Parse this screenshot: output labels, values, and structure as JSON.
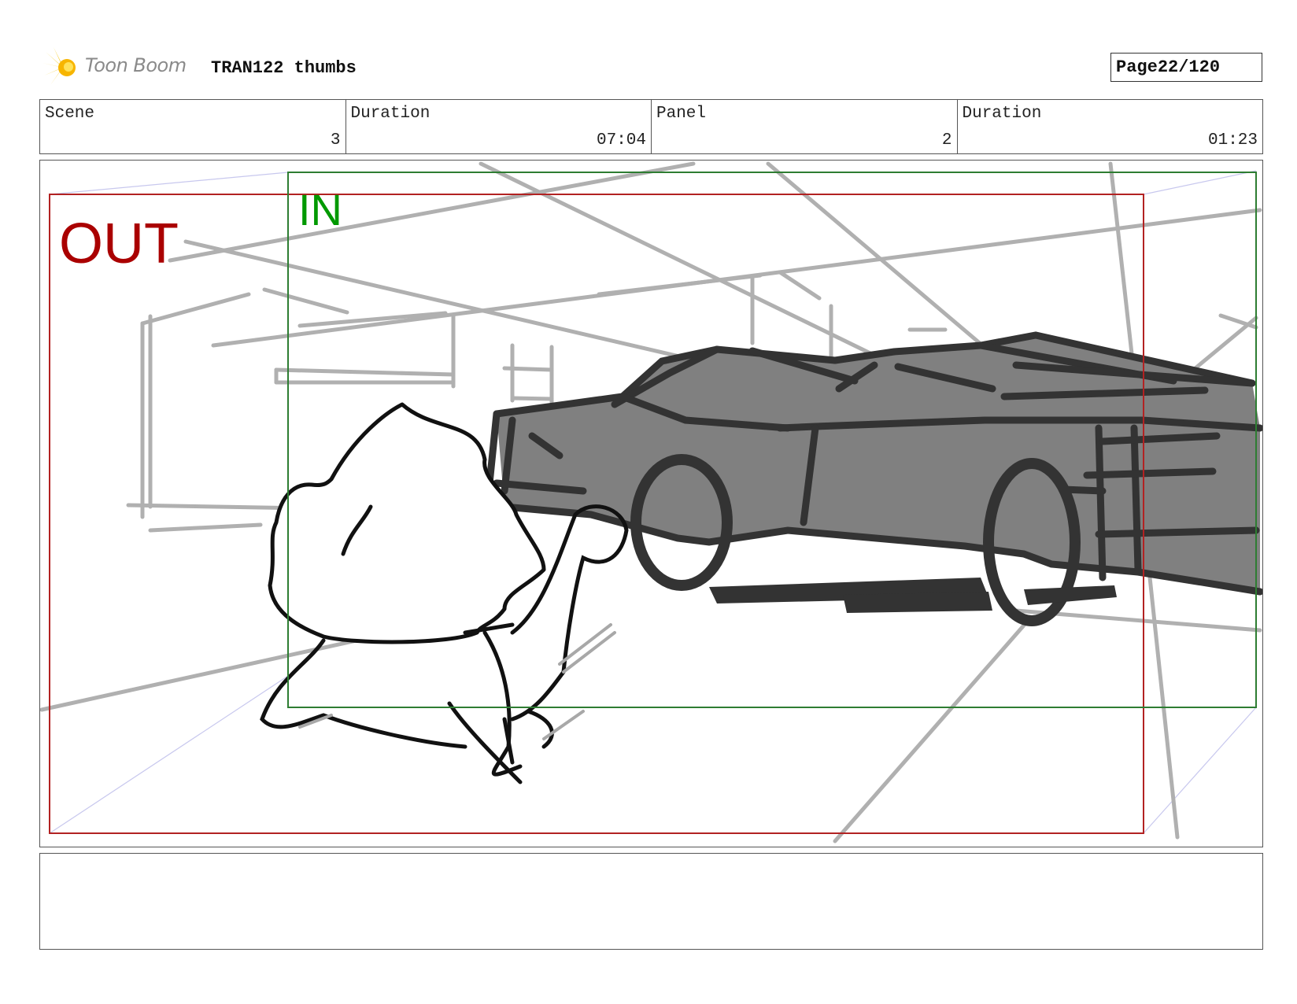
{
  "header": {
    "logo_text": "Toon Boom",
    "title": "TRAN122 thumbs",
    "page_label": "Page",
    "page_value": "22/120"
  },
  "info": {
    "scene_label": "Scene",
    "scene_value": "3",
    "scene_duration_label": "Duration",
    "scene_duration_value": "07:04",
    "panel_label": "Panel",
    "panel_value": "2",
    "panel_duration_label": "Duration",
    "panel_duration_value": "01:23"
  },
  "panel_image": {
    "out_label": "OUT",
    "in_label": "IN",
    "out_color": "#aa0000",
    "in_color": "#009900",
    "out_frame_color": "#b22222",
    "in_frame_color": "#2e7d32",
    "sketch_color": "#111111",
    "car_fill": "#808080",
    "guide_color": "#b0b0b0"
  },
  "notes": {
    "text": ""
  }
}
